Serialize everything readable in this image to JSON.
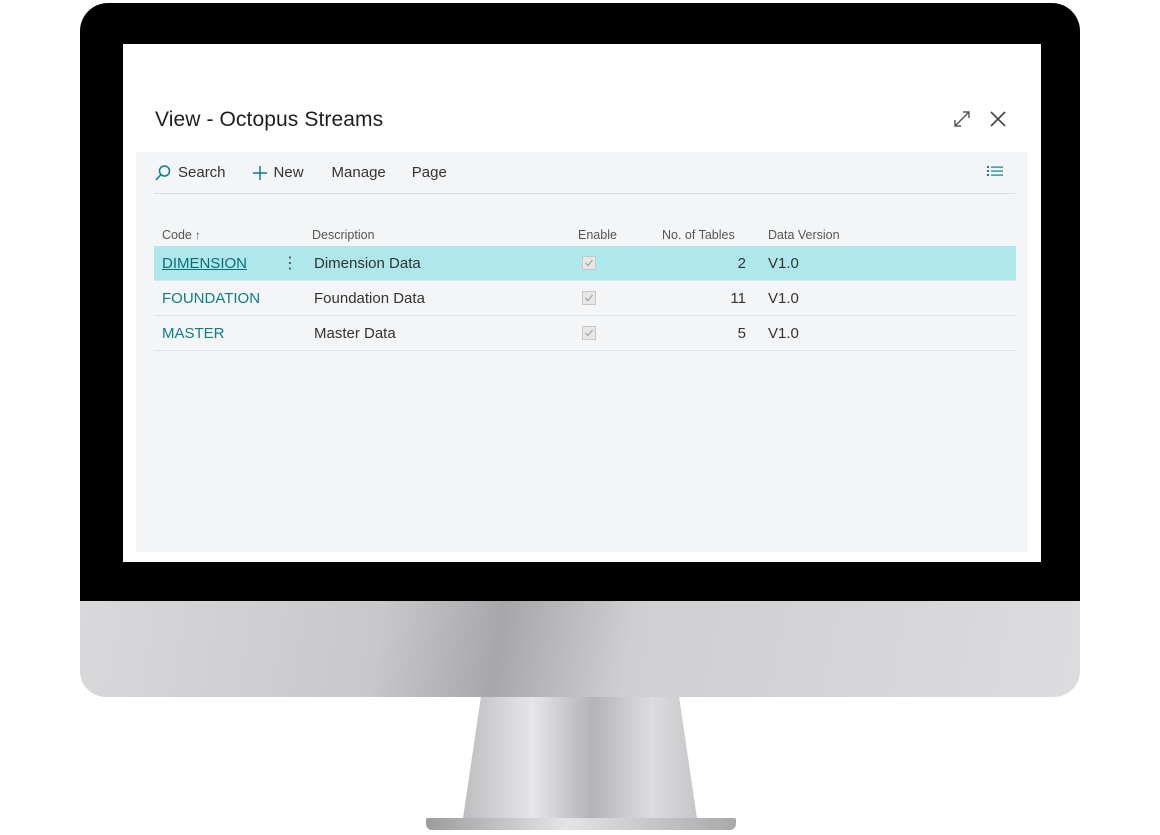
{
  "dialog": {
    "title": "View - Octopus Streams"
  },
  "icons": {
    "expand": "expand-icon",
    "close": "close-icon",
    "search": "search-icon",
    "new": "plus-icon",
    "list_view": "list-view-icon"
  },
  "actionbar": {
    "search_label": "Search",
    "new_label": "New",
    "manage_label": "Manage",
    "page_label": "Page"
  },
  "table": {
    "headers": {
      "code": "Code",
      "code_sort": "↑",
      "description": "Description",
      "enable": "Enable",
      "no_of_tables": "No. of Tables",
      "data_version": "Data Version"
    },
    "rows": [
      {
        "code": "DIMENSION",
        "description": "Dimension Data",
        "enable": true,
        "no_of_tables": "2",
        "data_version": "V1.0",
        "selected": true
      },
      {
        "code": "FOUNDATION",
        "description": "Foundation Data",
        "enable": true,
        "no_of_tables": "11",
        "data_version": "V1.0",
        "selected": false
      },
      {
        "code": "MASTER",
        "description": "Master Data",
        "enable": true,
        "no_of_tables": "5",
        "data_version": "V1.0",
        "selected": false
      }
    ]
  },
  "colors": {
    "accent": "#0d7f86",
    "selected_row": "#aee8ec",
    "panel_bg": "#f4f5f7"
  }
}
